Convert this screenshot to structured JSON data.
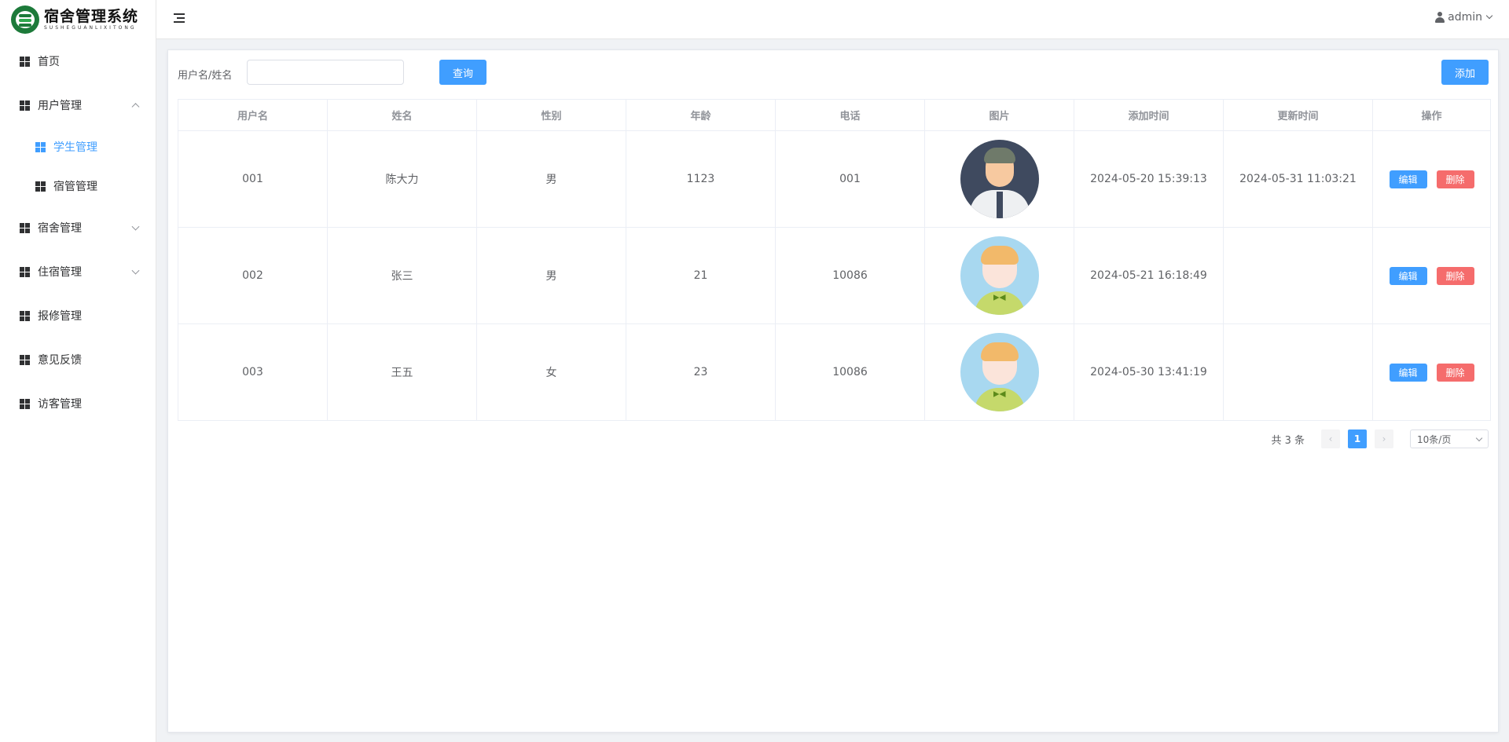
{
  "app": {
    "title": "宿舍管理系统",
    "subtitle": "SUSHEGUANLIXITONG",
    "brand_color": "#1d7a3a",
    "accent": "#409eff",
    "danger": "#f56c6c"
  },
  "sidebar": {
    "items": [
      {
        "label": "首页",
        "icon": "grid-icon"
      },
      {
        "label": "用户管理",
        "icon": "grid-icon",
        "expanded": true
      },
      {
        "label": "学生管理",
        "icon": "grid-icon",
        "active": true
      },
      {
        "label": "宿管管理",
        "icon": "grid-icon"
      },
      {
        "label": "宿舍管理",
        "icon": "grid-icon",
        "expanded": false
      },
      {
        "label": "住宿管理",
        "icon": "grid-icon",
        "expanded": false
      },
      {
        "label": "报修管理",
        "icon": "grid-icon"
      },
      {
        "label": "意见反馈",
        "icon": "grid-icon"
      },
      {
        "label": "访客管理",
        "icon": "grid-icon"
      }
    ]
  },
  "header": {
    "user": "admin"
  },
  "toolbar": {
    "search_label": "用户名/姓名",
    "search_value": "",
    "query_label": "查询",
    "add_label": "添加"
  },
  "table": {
    "columns": [
      "用户名",
      "姓名",
      "性别",
      "年龄",
      "电话",
      "图片",
      "添加时间",
      "更新时间",
      "操作"
    ],
    "rows": [
      {
        "username": "001",
        "name": "陈大力",
        "gender": "男",
        "age": "1123",
        "phone": "001",
        "avatar": "man-avatar",
        "created": "2024-05-20 15:39:13",
        "updated": "2024-05-31 11:03:21"
      },
      {
        "username": "002",
        "name": "张三",
        "gender": "男",
        "age": "21",
        "phone": "10086",
        "avatar": "kid-avatar",
        "created": "2024-05-21 16:18:49",
        "updated": ""
      },
      {
        "username": "003",
        "name": "王五",
        "gender": "女",
        "age": "23",
        "phone": "10086",
        "avatar": "kid-avatar",
        "created": "2024-05-30 13:41:19",
        "updated": ""
      }
    ],
    "edit_label": "编辑",
    "delete_label": "删除"
  },
  "pagination": {
    "total_text": "共 3 条",
    "prev": "‹",
    "current_page": "1",
    "next": "›",
    "page_size": "10条/页"
  }
}
